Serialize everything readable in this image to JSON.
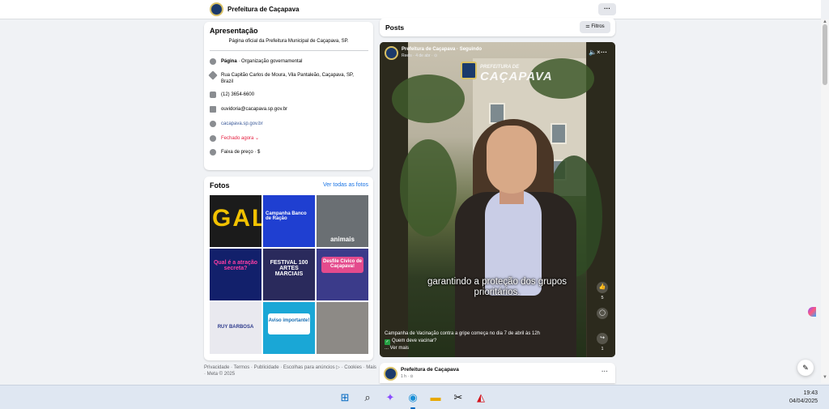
{
  "page": {
    "name": "Prefeitura de Caçapava",
    "more_label": "···"
  },
  "intro": {
    "title": "Apresentação",
    "bio": "Página oficial da Prefeitura Municipal de Caçapava, SP.",
    "category_bold": "Página",
    "category_rest": " · Organização governamental",
    "address": "Rua Capitão Carlos de Moura, Vila Pantaleão, Caçapava, SP, Brazil",
    "phone": "(12) 3654-6600",
    "email": "ouvidoria@cacapava.sp.gov.br",
    "website": "cacapava.sp.gov.br",
    "hours": "Fechado agora",
    "hours_chevron": "⌄",
    "price": "Faixa de preço · $"
  },
  "photos": {
    "title": "Fotos",
    "see_all": "Ver todas as fotos",
    "items": [
      {
        "text": "GALA",
        "bg": "#1b1b1b",
        "fg": "#f2c200"
      },
      {
        "text": "Campanha Banco de Ração",
        "bg": "#1f3fd1",
        "fg": "#ffffff"
      },
      {
        "text": "animais",
        "bg": "#6a6f73",
        "fg": "#ffffff"
      },
      {
        "text": "Qual é a atração secreta?",
        "bg": "#12206b",
        "fg": "#ff3ea5"
      },
      {
        "text": "FESTIVAL 100 ARTES MARCIAIS",
        "bg": "#2a2a5c",
        "fg": "#ffffff"
      },
      {
        "text": "Desfile Cívico de Caçapava!",
        "bg": "#3b3b8a",
        "fg": "#ffffff"
      },
      {
        "text": "RUY BARBOSA",
        "bg": "#e9e9ef",
        "fg": "#2d3a8c"
      },
      {
        "text": "Aviso importante!",
        "bg": "#1aa7d6",
        "fg": "#ffffff"
      },
      {
        "text": "",
        "bg": "#8d8a86",
        "fg": "#ffffff"
      }
    ]
  },
  "footer": "Privacidade · Termos · Publicidade · Escolhas para anúncios ▷ · Cookies · Mais · Meta © 2025",
  "posts": {
    "title": "Posts",
    "filter": "Filtros",
    "reel": {
      "author": "Prefeitura de Caçapava · Seguindo",
      "meta": "Reels · 4 de abr · ⊙",
      "logo_small": "PREFEITURA DE",
      "logo_big": "CAÇAPAVA",
      "caption": "garantindo a proteção dos grupos prioritários.",
      "like_count": "5",
      "share_count": "1",
      "desc_line1": "Campanha de Vacinação contra a gripe começa no dia 7 de abril às 12h",
      "desc_line2": "Quem deve vacinar?",
      "desc_line3": "... Ver mais",
      "check_mark": "✓",
      "mute_icon": "🔈×",
      "more_icon": "···",
      "like_icon": "👍",
      "comment_icon": "◯",
      "share_icon": "↪"
    },
    "next_post": {
      "author": "Prefeitura de Caçapava",
      "time": "1 h · ⊙",
      "more": "···"
    }
  },
  "taskbar": {
    "time": "19:43",
    "date": "04/04/2025",
    "icons": [
      "windows",
      "search",
      "copilot",
      "edge",
      "file-explorer",
      "capcut",
      "acrobat"
    ]
  }
}
